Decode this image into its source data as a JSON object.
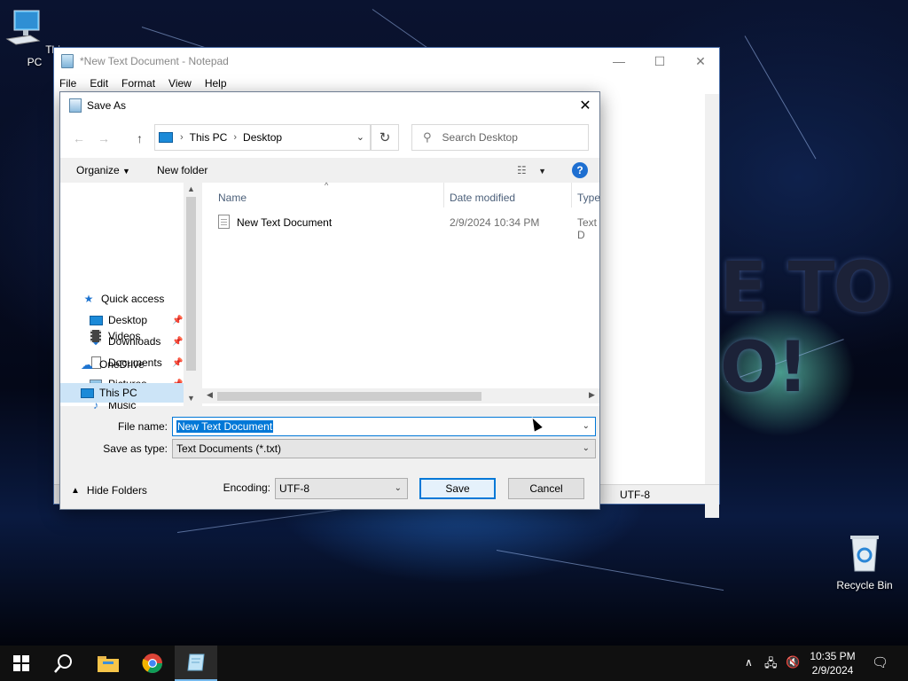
{
  "desktop": {
    "this_pc_label": "This PC",
    "recycle_bin_label": "Recycle Bin"
  },
  "notepad": {
    "title": "*New Text Document - Notepad",
    "menu": [
      "File",
      "Edit",
      "Format",
      "View",
      "Help"
    ],
    "status_encoding": "UTF-8"
  },
  "dialog": {
    "title": "Save As",
    "address": {
      "segments": [
        "This PC",
        "Desktop"
      ]
    },
    "search_placeholder": "Search Desktop",
    "organize_label": "Organize",
    "new_folder_label": "New folder",
    "help_label": "?",
    "nav_items": [
      {
        "label": "Quick access",
        "icon": "star-icon"
      },
      {
        "label": "Desktop",
        "icon": "desktop-folder-icon",
        "pinned": true
      },
      {
        "label": "Downloads",
        "icon": "download-arrow-icon",
        "pinned": true
      },
      {
        "label": "Documents",
        "icon": "documents-icon",
        "pinned": true
      },
      {
        "label": "Pictures",
        "icon": "pictures-icon",
        "pinned": true
      },
      {
        "label": "Music",
        "icon": "music-note-icon"
      },
      {
        "label": "Videos",
        "icon": "film-icon"
      },
      {
        "label": "OneDrive",
        "icon": "cloud-icon"
      },
      {
        "label": "This PC",
        "icon": "computer-icon",
        "selected": true
      }
    ],
    "columns": [
      "Name",
      "Date modified",
      "Type"
    ],
    "files": [
      {
        "name": "New Text Document",
        "date_modified": "2/9/2024 10:34 PM",
        "type": "Text D"
      }
    ],
    "file_name_label": "File name:",
    "file_name_value": "New Text Document",
    "save_as_type_label": "Save as type:",
    "save_as_type_value": "Text Documents (*.txt)",
    "hide_folders_label": "Hide Folders",
    "encoding_label": "Encoding:",
    "encoding_value": "UTF-8",
    "save_label": "Save",
    "cancel_label": "Cancel"
  },
  "taskbar": {
    "time": "10:35 PM",
    "date": "2/9/2024",
    "items": [
      "start-windows-icon",
      "search-icon",
      "file-explorer-icon",
      "chrome-icon",
      "notepad-icon"
    ]
  },
  "colors": {
    "accent": "#0078d7",
    "selection": "#cce4f7",
    "taskbar": "#101010"
  }
}
